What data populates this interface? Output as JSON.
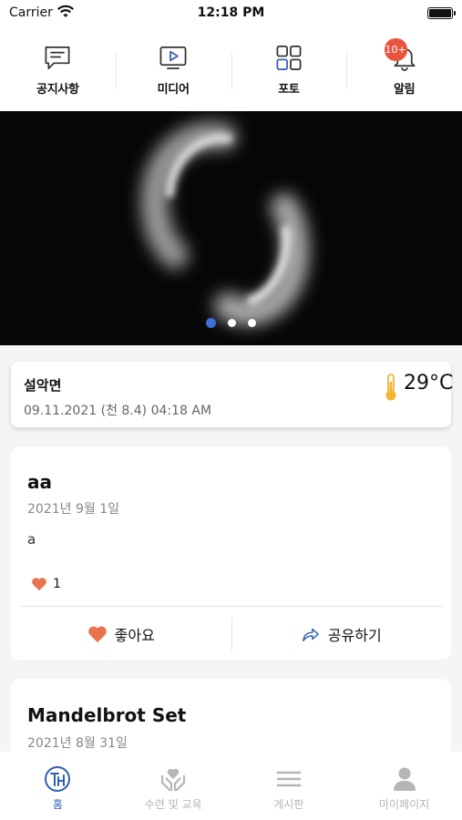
{
  "status_bar": {
    "carrier": "Carrier",
    "time": "12:18 PM"
  },
  "top_nav": {
    "items": [
      {
        "label": "공지사항",
        "icon": "notice-icon"
      },
      {
        "label": "미디어",
        "icon": "media-icon"
      },
      {
        "label": "포토",
        "icon": "photo-grid-icon"
      },
      {
        "label": "알림",
        "icon": "bell-icon",
        "badge": "10+"
      }
    ]
  },
  "banner": {
    "slide_count": 3,
    "active_slide": 0,
    "dot_active_color": "#3a6fd8"
  },
  "weather": {
    "location": "설악면",
    "datetime": "09.11.2021 (천 8.4) 04:18 AM",
    "temperature": "29°C",
    "icon": "thermometer-icon"
  },
  "posts": [
    {
      "title": "aa",
      "date": "2021년 9월 1일",
      "body": "a",
      "like_count": "1",
      "like_label": "좋아요",
      "share_label": "공유하기"
    },
    {
      "title": "Mandelbrot Set",
      "date": "2021년 8월 31일"
    }
  ],
  "tab_bar": {
    "tabs": [
      {
        "label": "홈",
        "icon": "home-logo-icon",
        "active": true
      },
      {
        "label": "수련 및 교육",
        "icon": "heart-hands-icon",
        "active": false
      },
      {
        "label": "게시판",
        "icon": "menu-lines-icon",
        "active": false
      },
      {
        "label": "마이페이지",
        "icon": "person-icon",
        "active": false
      }
    ]
  },
  "colors": {
    "accent": "#2f5fb3",
    "badge": "#e8553f",
    "heart": "#e8734e",
    "thermo": "#f2b531"
  }
}
